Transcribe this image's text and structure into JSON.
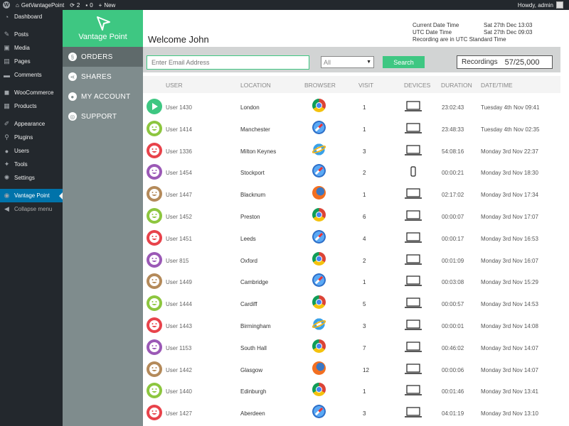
{
  "adminbar": {
    "site_name": "GetVantagePoint",
    "updates_count": "2",
    "comments_count": "0",
    "new_label": "New",
    "howdy": "Howdy, admin"
  },
  "wp_menu": {
    "items": [
      {
        "label": "Dashboard",
        "icon": "dashboard-icon"
      },
      {
        "label": "Posts",
        "icon": "pin-icon"
      },
      {
        "label": "Media",
        "icon": "media-icon"
      },
      {
        "label": "Pages",
        "icon": "page-icon"
      },
      {
        "label": "Comments",
        "icon": "comment-icon"
      },
      {
        "label": "WooCommerce",
        "icon": "woo-icon"
      },
      {
        "label": "Products",
        "icon": "products-icon"
      },
      {
        "label": "Appearance",
        "icon": "brush-icon"
      },
      {
        "label": "Plugins",
        "icon": "plug-icon"
      },
      {
        "label": "Users",
        "icon": "user-icon"
      },
      {
        "label": "Tools",
        "icon": "wrench-icon"
      },
      {
        "label": "Settings",
        "icon": "gear-icon"
      },
      {
        "label": "Vantage Point",
        "icon": "vantage-icon"
      },
      {
        "label": "Collapse menu",
        "icon": "collapse-icon"
      }
    ]
  },
  "vp": {
    "logo_text": "Vantage Point",
    "nav": [
      {
        "label": "ORDERS"
      },
      {
        "label": "SHARES"
      },
      {
        "label": "MY ACCOUNT"
      },
      {
        "label": "SUPPORT"
      }
    ]
  },
  "main": {
    "welcome": "Welcome John",
    "current_label": "Current Date Time",
    "current_value": "Sat 27th Dec 13:03",
    "utc_label": "UTC Date Time",
    "utc_value": "Sat 27th Dec 09:03",
    "utc_note": "Recording are in UTC Standard Time",
    "email_placeholder": "Enter Email Address",
    "filter_selected": "All",
    "search_label": "Search",
    "recordings_label": "Recordings",
    "recordings_count": "57/25,000"
  },
  "columns": {
    "user": "USER",
    "location": "LOCATION",
    "browser": "BROWSER",
    "visit": "VISIT",
    "devices": "DEVICES",
    "duration": "DURATION",
    "date": "DATE/TIME"
  },
  "colors": {
    "accent": "#3ec782",
    "green_face": "#8dc63f",
    "red_face": "#e8434b",
    "purple_face": "#9b59b6",
    "brown_face": "#b48a5a"
  },
  "rows": [
    {
      "user": "User 1430",
      "location": "London",
      "browser": "chrome",
      "visit": "1",
      "device": "laptop",
      "duration": "23:02:43",
      "date": "Tuesday 4th Nov 09:41",
      "avatar": "play",
      "face": "#3ec782"
    },
    {
      "user": "User 1414",
      "location": "Manchester",
      "browser": "safari",
      "visit": "1",
      "device": "laptop",
      "duration": "23:48:33",
      "date": "Tuesday 4th Nov 02:35",
      "avatar": "smile",
      "face": "#8dc63f"
    },
    {
      "user": "User 1336",
      "location": "Milton Keynes",
      "browser": "ie",
      "visit": "3",
      "device": "laptop",
      "duration": "54:08:16",
      "date": "Monday 3rd Nov 22:37",
      "avatar": "smile",
      "face": "#e8434b"
    },
    {
      "user": "User 1454",
      "location": "Stockport",
      "browser": "safari",
      "visit": "2",
      "device": "phone",
      "duration": "00:00:21",
      "date": "Monday 3rd Nov 18:30",
      "avatar": "smile",
      "face": "#9b59b6"
    },
    {
      "user": "User 1447",
      "location": "Blacknum",
      "browser": "firefox",
      "visit": "1",
      "device": "laptop",
      "duration": "02:17:02",
      "date": "Monday 3rd Nov 17:34",
      "avatar": "smile",
      "face": "#b48a5a"
    },
    {
      "user": "User 1452",
      "location": "Preston",
      "browser": "chrome",
      "visit": "6",
      "device": "laptop",
      "duration": "00:00:07",
      "date": "Monday 3rd Nov 17:07",
      "avatar": "smile",
      "face": "#8dc63f"
    },
    {
      "user": "User 1451",
      "location": "Leeds",
      "browser": "safari",
      "visit": "4",
      "device": "laptop",
      "duration": "00:00:17",
      "date": "Monday 3rd Nov 16:53",
      "avatar": "smile",
      "face": "#e8434b"
    },
    {
      "user": "User 815",
      "location": "Oxford",
      "browser": "chrome",
      "visit": "2",
      "device": "laptop",
      "duration": "00:01:09",
      "date": "Monday 3rd Nov 16:07",
      "avatar": "smile",
      "face": "#9b59b6"
    },
    {
      "user": "User 1449",
      "location": "Cambridge",
      "browser": "safari",
      "visit": "1",
      "device": "laptop",
      "duration": "00:03:08",
      "date": "Monday 3rd Nov 15:29",
      "avatar": "smile",
      "face": "#b48a5a"
    },
    {
      "user": "User 1444",
      "location": "Cardiff",
      "browser": "chrome",
      "visit": "5",
      "device": "laptop",
      "duration": "00:00:57",
      "date": "Monday 3rd Nov 14:53",
      "avatar": "smile",
      "face": "#8dc63f"
    },
    {
      "user": "User 1443",
      "location": "Birmingham",
      "browser": "ie",
      "visit": "3",
      "device": "laptop",
      "duration": "00:00:01",
      "date": "Monday 3rd Nov 14:08",
      "avatar": "smile",
      "face": "#e8434b"
    },
    {
      "user": "User 1153",
      "location": "South Hall",
      "browser": "chrome",
      "visit": "7",
      "device": "laptop",
      "duration": "00:46:02",
      "date": "Monday 3rd Nov 14:07",
      "avatar": "smile",
      "face": "#9b59b6"
    },
    {
      "user": "User 1442",
      "location": "Glasgow",
      "browser": "firefox",
      "visit": "12",
      "device": "laptop",
      "duration": "00:00:06",
      "date": "Monday 3rd Nov 14:07",
      "avatar": "smile",
      "face": "#b48a5a"
    },
    {
      "user": "User 1440",
      "location": "Edinburgh",
      "browser": "chrome",
      "visit": "1",
      "device": "laptop",
      "duration": "00:01:46",
      "date": "Monday 3rd Nov 13:41",
      "avatar": "smile",
      "face": "#8dc63f"
    },
    {
      "user": "User 1427",
      "location": "Aberdeen",
      "browser": "safari",
      "visit": "3",
      "device": "laptop",
      "duration": "04:01:19",
      "date": "Monday 3rd Nov 13:10",
      "avatar": "smile",
      "face": "#e8434b"
    }
  ]
}
